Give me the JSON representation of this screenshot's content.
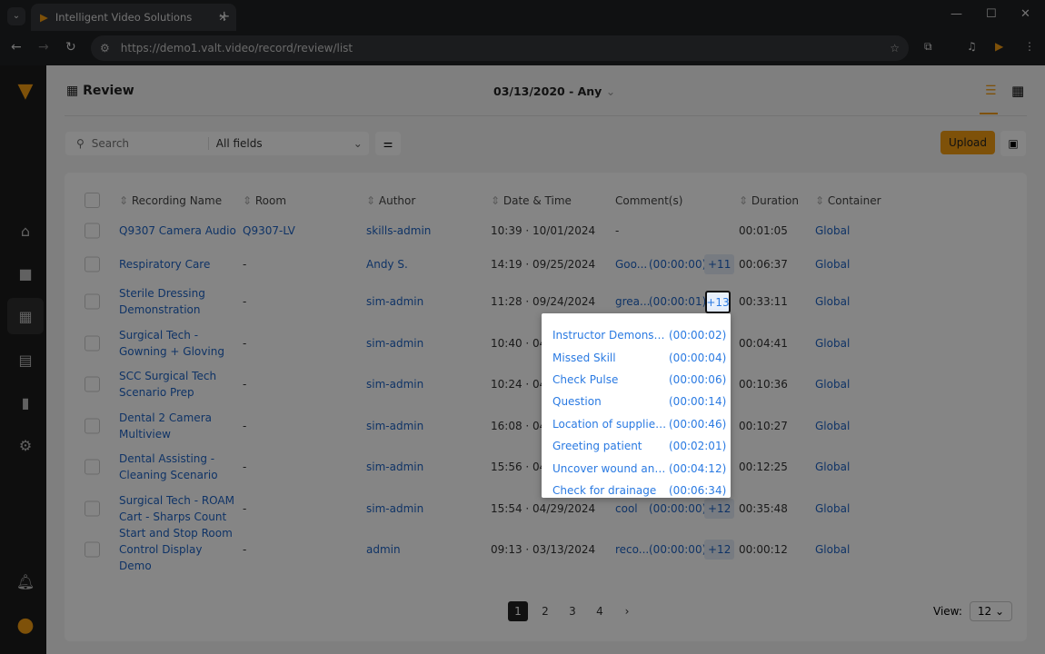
{
  "browser": {
    "tab_title": "Intelligent Video Solutions",
    "url": "https://demo1.valt.video/record/review/list"
  },
  "header": {
    "title": "Review",
    "date_range": "03/13/2020 - Any"
  },
  "search": {
    "placeholder": "Search",
    "field_select": "All fields"
  },
  "toolbar": {
    "upload_label": "Upload"
  },
  "table": {
    "columns": [
      "Recording Name",
      "Room",
      "Author",
      "Date & Time",
      "Comment(s)",
      "Duration",
      "Container"
    ],
    "rows": [
      {
        "name": "Q9307 Camera Audio",
        "room": "Q9307-LV",
        "author": "skills-admin",
        "datetime": "10:39 · 10/01/2024",
        "comment": "-",
        "comment_time": "",
        "more": "",
        "duration": "00:01:05",
        "container": "Global"
      },
      {
        "name": "Respiratory Care",
        "room": "-",
        "author": "Andy S.",
        "datetime": "14:19 · 09/25/2024",
        "comment": "Goo...",
        "comment_time": "(00:00:00)",
        "more": "+11",
        "duration": "00:06:37",
        "container": "Global"
      },
      {
        "name": "Sterile Dressing Demonstration",
        "room": "-",
        "author": "sim-admin",
        "datetime": "11:28 · 09/24/2024",
        "comment": "grea...",
        "comment_time": "(00:00:01)",
        "more": "+13",
        "duration": "00:33:11",
        "container": "Global"
      },
      {
        "name": "Surgical Tech - Gowning + Gloving",
        "room": "-",
        "author": "sim-admin",
        "datetime": "10:40 · 04.",
        "comment": "",
        "comment_time": "",
        "more": "",
        "duration": "00:04:41",
        "container": "Global"
      },
      {
        "name": "SCC Surgical Tech Scenario Prep",
        "room": "-",
        "author": "sim-admin",
        "datetime": "10:24 · 04.",
        "comment": "",
        "comment_time": "",
        "more": "",
        "duration": "00:10:36",
        "container": "Global"
      },
      {
        "name": "Dental 2 Camera Multiview",
        "room": "-",
        "author": "sim-admin",
        "datetime": "16:08 · 04.",
        "comment": "",
        "comment_time": "",
        "more": "",
        "duration": "00:10:27",
        "container": "Global"
      },
      {
        "name": "Dental Assisting - Cleaning Scenario",
        "room": "-",
        "author": "sim-admin",
        "datetime": "15:56 · 04.",
        "comment": "",
        "comment_time": "",
        "more": "",
        "duration": "00:12:25",
        "container": "Global"
      },
      {
        "name": "Surgical Tech - ROAM Cart - Sharps Count",
        "room": "-",
        "author": "sim-admin",
        "datetime": "15:54 · 04/29/2024",
        "comment": "cool",
        "comment_time": "(00:00:00)",
        "more": "+12",
        "duration": "00:35:48",
        "container": "Global"
      },
      {
        "name": "Start and Stop Room Control Display Demo",
        "room": "-",
        "author": "admin",
        "datetime": "09:13 · 03/13/2024",
        "comment": "reco...",
        "comment_time": "(00:00:00)",
        "more": "+12",
        "duration": "00:00:12",
        "container": "Global"
      }
    ]
  },
  "comments_popup": [
    {
      "label": "Instructor Demonstr...",
      "time": "(00:00:02)"
    },
    {
      "label": "Missed Skill",
      "time": "(00:00:04)"
    },
    {
      "label": "Check Pulse",
      "time": "(00:00:06)"
    },
    {
      "label": "Question",
      "time": "(00:00:14)"
    },
    {
      "label": "Location of supplies ...",
      "time": "(00:00:46)"
    },
    {
      "label": "Greeting patient",
      "time": "(00:02:01)"
    },
    {
      "label": "Uncover wound and ...",
      "time": "(00:04:12)"
    },
    {
      "label": "Check for drainage",
      "time": "(00:06:34)"
    }
  ],
  "pagination": {
    "pages": [
      "1",
      "2",
      "3",
      "4"
    ],
    "current": "1",
    "next": "›",
    "view_label": "View:",
    "view_value": "12"
  },
  "colors": {
    "accent": "#f29b13",
    "link": "#1e63c4"
  }
}
